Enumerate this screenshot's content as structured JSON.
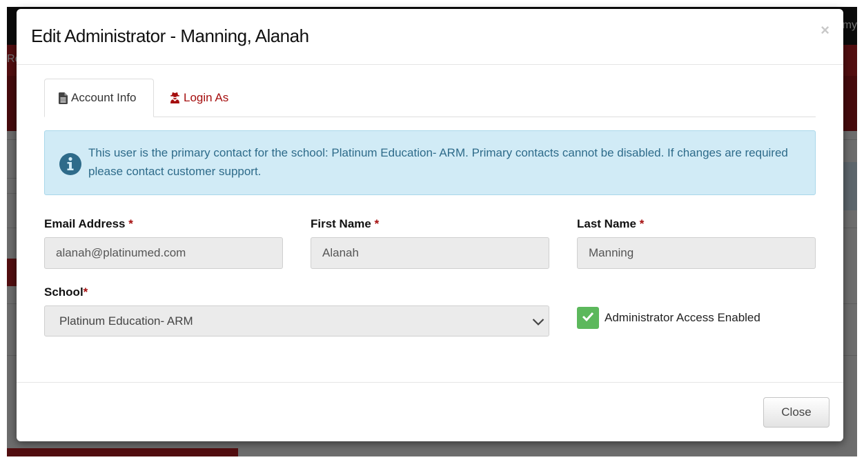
{
  "background": {
    "top_right_text": "my",
    "nav_text": "Re"
  },
  "modal": {
    "title": "Edit Administrator - Manning, Alanah",
    "close_symbol": "×",
    "tabs": [
      {
        "label": "Account Info",
        "icon": "document-icon",
        "active": true
      },
      {
        "label": "Login As",
        "icon": "user-secret-icon",
        "active": false,
        "color": "#a50e0e"
      }
    ],
    "alert": {
      "icon": "info-icon",
      "text": "This user is the primary contact for the school: Platinum Education- ARM. Primary contacts cannot be disabled. If changes are required please contact customer support.",
      "background": "#d1ebf6",
      "text_color": "#2e6b8a"
    },
    "form": {
      "email": {
        "label": "Email Address",
        "required_mark": "*",
        "value": "alanah@platinumed.com"
      },
      "first_name": {
        "label": "First Name",
        "required_mark": "*",
        "value": "Alanah"
      },
      "last_name": {
        "label": "Last Name",
        "required_mark": "*",
        "value": "Manning"
      },
      "school": {
        "label": "School",
        "required_mark": "*",
        "selected": "Platinum Education- ARM"
      },
      "admin_access": {
        "label": "Administrator Access Enabled",
        "checked": true,
        "color": "#5cb85c"
      }
    },
    "footer": {
      "close_label": "Close"
    }
  },
  "colors": {
    "required": "#a50e0e",
    "checkbox_green": "#5cb85c",
    "background_red": "#b51f24"
  }
}
